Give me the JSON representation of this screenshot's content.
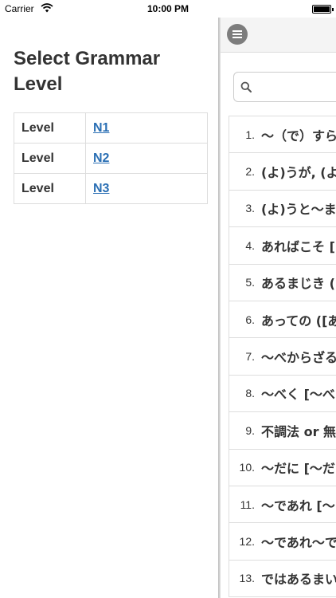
{
  "status_bar": {
    "carrier": "Carrier",
    "time": "10:00 PM"
  },
  "left_panel": {
    "title": "Select Grammar Level",
    "levels": [
      {
        "label": "Level",
        "link": "N1"
      },
      {
        "label": "Level",
        "link": "N2"
      },
      {
        "label": "Level",
        "link": "N3"
      }
    ]
  },
  "right_panel": {
    "menu_icon": "menu-icon",
    "search_icon": "search-icon",
    "search_placeholder": "",
    "items": [
      {
        "num": "1.",
        "text": "～（で）すら"
      },
      {
        "num": "2.",
        "text": "(よ)うが, (よ)"
      },
      {
        "num": "3.",
        "text": "(よ)うと～ま"
      },
      {
        "num": "4.",
        "text": "あればこそ ["
      },
      {
        "num": "5.",
        "text": "あるまじき (["
      },
      {
        "num": "6.",
        "text": "あっての ([あ"
      },
      {
        "num": "7.",
        "text": "～べからざる"
      },
      {
        "num": "8.",
        "text": "～べく [～べ"
      },
      {
        "num": "9.",
        "text": "不調法 or 無"
      },
      {
        "num": "10.",
        "text": "～だに [～だ"
      },
      {
        "num": "11.",
        "text": "～であれ [～"
      },
      {
        "num": "12.",
        "text": "～であれ～で"
      },
      {
        "num": "13.",
        "text": "ではあるまい"
      }
    ]
  },
  "colors": {
    "link": "#2a6fb4",
    "menu_button": "#7d7d7d",
    "border": "#dddddd"
  }
}
